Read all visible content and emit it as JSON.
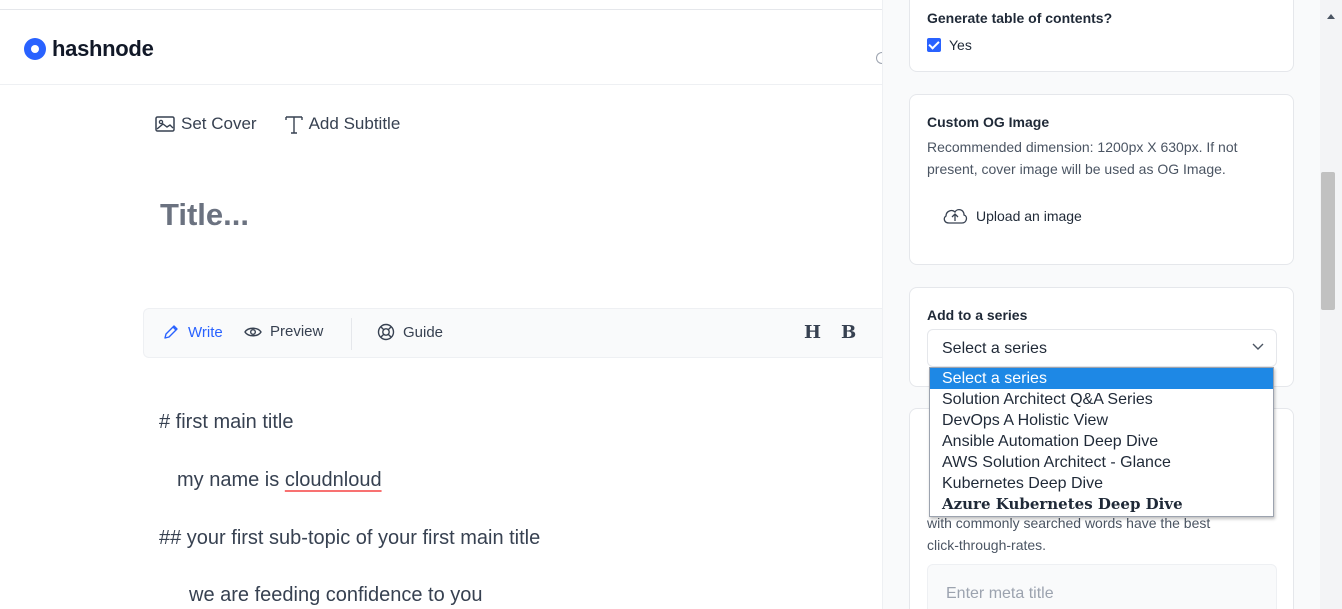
{
  "header": {
    "brand": "hashnode"
  },
  "editor": {
    "set_cover": "Set Cover",
    "add_subtitle": "Add Subtitle",
    "title_placeholder": "Title...",
    "toolbar": {
      "write": "Write",
      "preview": "Preview",
      "guide": "Guide",
      "heading_btn": "H",
      "bold_btn": "B"
    },
    "content": {
      "line1": "# first main title",
      "line2_prefix": "my name is ",
      "line2_word": "cloudnloud",
      "line3": "## your first sub-topic of your first main title",
      "line4": "we are feeding confidence to you"
    }
  },
  "panel": {
    "toc": {
      "title": "Generate table of contents?",
      "option": "Yes",
      "checked": true
    },
    "og_image": {
      "title": "Custom OG Image",
      "description": "Recommended dimension: 1200px X 630px. If not present, cover image will be used as OG Image.",
      "upload": "Upload an image"
    },
    "series": {
      "title": "Add to a series",
      "selected": "Select a series",
      "options": [
        "Select a series",
        "Solution Architect Q&A Series",
        "DevOps A Holistic View",
        "Ansible Automation Deep Dive",
        "AWS Solution Architect - Glance",
        "Kubernetes Deep Dive",
        "Azure Kubernetes Deep Dive"
      ]
    },
    "seo": {
      "desc_tail_1": "with commonly searched words have the best",
      "desc_tail_2": "click-through-rates.",
      "meta_title_placeholder": "Enter meta title"
    }
  },
  "colors": {
    "accent": "#2962ff",
    "dropdown_highlight": "#1e88e5"
  }
}
